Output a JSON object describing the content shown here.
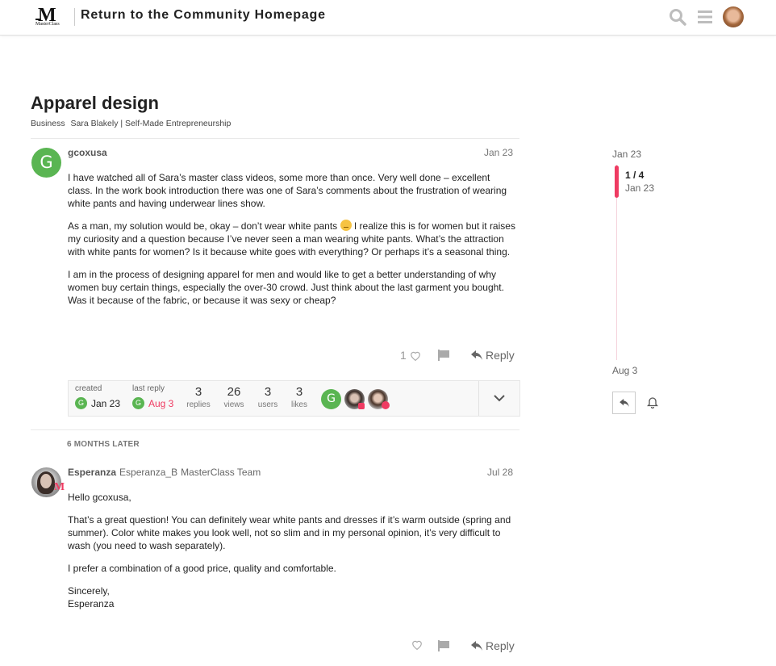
{
  "header": {
    "logo_text": "MasterClass",
    "title": "Return to the Community Homepage",
    "icons": [
      "search-icon",
      "hamburger-menu-icon",
      "user-avatar"
    ]
  },
  "topic": {
    "title": "Apparel design",
    "categories": [
      "Business",
      "Sara Blakely | Self-Made Entrepreneurship"
    ]
  },
  "posts": [
    {
      "avatar_letter": "G",
      "username": "gcoxusa",
      "date": "Jan 23",
      "paragraphs": [
        "I have watched all of Sara’s master class videos, some more than once. Very well done – excellent class. In the work book introduction there was one of Sara’s comments about the frustration of wearing white pants and having underwear lines show.",
        "As a man, my solution would be, okay – don’t wear white pants",
        "I realize this is for women but it raises my curiosity and a question because I’ve never seen a man wearing white pants. What’s the attraction with white pants for women? Is it because white goes with everything? Or perhaps it’s a seasonal thing.",
        "I am in the process of designing apparel for men and would like to get a better understanding of why women buy certain things, especially the over-30 crowd. Just think about the last garment you bought. Was it because of the fabric, or because it was sexy or cheap?"
      ],
      "emoji": "slightly-smiling-face",
      "like_count": "1",
      "reply_label": "Reply"
    },
    {
      "username": "Esperanza",
      "handle": "Esperanza_B",
      "title": "MasterClass Team",
      "date": "Jul 28",
      "paragraphs": [
        "Hello gcoxusa,",
        "That’s a great question! You can definitely wear white pants and dresses if it’s warm outside (spring and summer). Color white makes you look well, not so slim and in my personal opinion, it’s very difficult to wash (you need to wash separately).",
        "I prefer a combination of a good price, quality and comfortable.",
        "Sincerely,",
        "Esperanza"
      ],
      "like_count": "",
      "reply_label": "Reply"
    }
  ],
  "topic_map": {
    "created_label": "created",
    "created_avatar": "G",
    "created_date": "Jan 23",
    "last_reply_label": "last reply",
    "last_reply_avatar": "G",
    "last_reply_date": "Aug 3",
    "stats": [
      {
        "value": "3",
        "label": "replies"
      },
      {
        "value": "26",
        "label": "views"
      },
      {
        "value": "3",
        "label": "users"
      },
      {
        "value": "3",
        "label": "likes"
      }
    ],
    "participant_initial": "G"
  },
  "time_gap": "6 MONTHS LATER",
  "timeline": {
    "start_date": "Jan 23",
    "position": "1 / 4",
    "position_date": "Jan 23",
    "end_date": "Aug 3"
  },
  "colors": {
    "accent": "#ef3b62",
    "avatar_green": "#5ab552"
  }
}
